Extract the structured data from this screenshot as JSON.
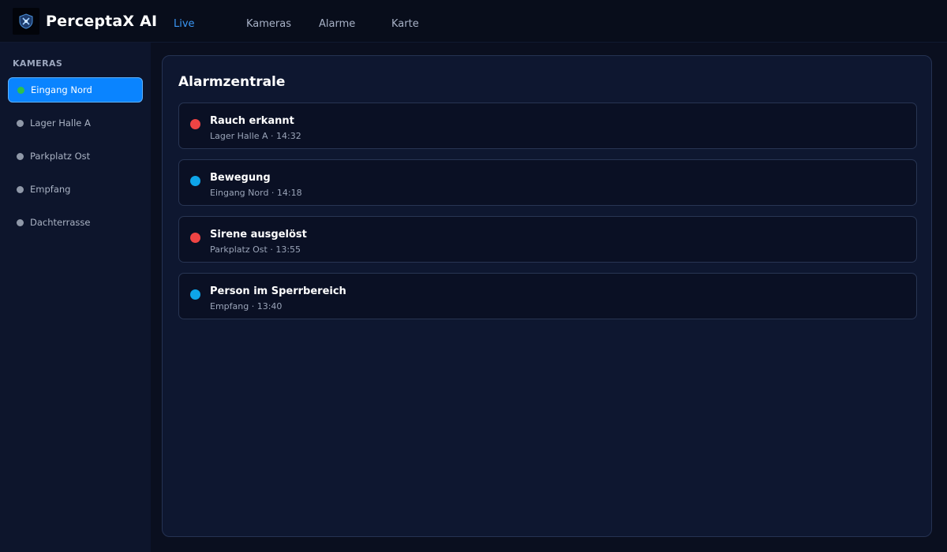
{
  "app": {
    "brand": "PerceptaX AI",
    "logo_icon": "shield-logo-icon"
  },
  "nav": {
    "items": [
      {
        "label": "Live",
        "active": true
      },
      {
        "label": "Kameras",
        "active": false
      },
      {
        "label": "Alarme",
        "active": false
      },
      {
        "label": "Karte",
        "active": false
      }
    ]
  },
  "sidebar": {
    "heading": "KAMERAS",
    "items": [
      {
        "label": "Eingang Nord",
        "active": true,
        "status": "online"
      },
      {
        "label": "Lager Halle A",
        "active": false,
        "status": "idle"
      },
      {
        "label": "Parkplatz Ost",
        "active": false,
        "status": "idle"
      },
      {
        "label": "Empfang",
        "active": false,
        "status": "idle"
      },
      {
        "label": "Dachterrasse",
        "active": false,
        "status": "idle"
      }
    ]
  },
  "main": {
    "title": "Alarmzentrale",
    "alarms": [
      {
        "title": "Rauch erkannt",
        "meta": "Lager Halle A · 14:32",
        "color": "#ef4444"
      },
      {
        "title": "Bewegung",
        "meta": "Eingang Nord · 14:18",
        "color": "#0ea5e9"
      },
      {
        "title": "Sirene ausgelöst",
        "meta": "Parkplatz Ost · 13:55",
        "color": "#ef4444"
      },
      {
        "title": "Person im Sperrbereich",
        "meta": "Empfang · 13:40",
        "color": "#0ea5e9"
      }
    ]
  },
  "colors": {
    "accent": "#0a84ff",
    "online": "#2ec14e",
    "critical": "#ef4444",
    "info": "#0ea5e9"
  }
}
